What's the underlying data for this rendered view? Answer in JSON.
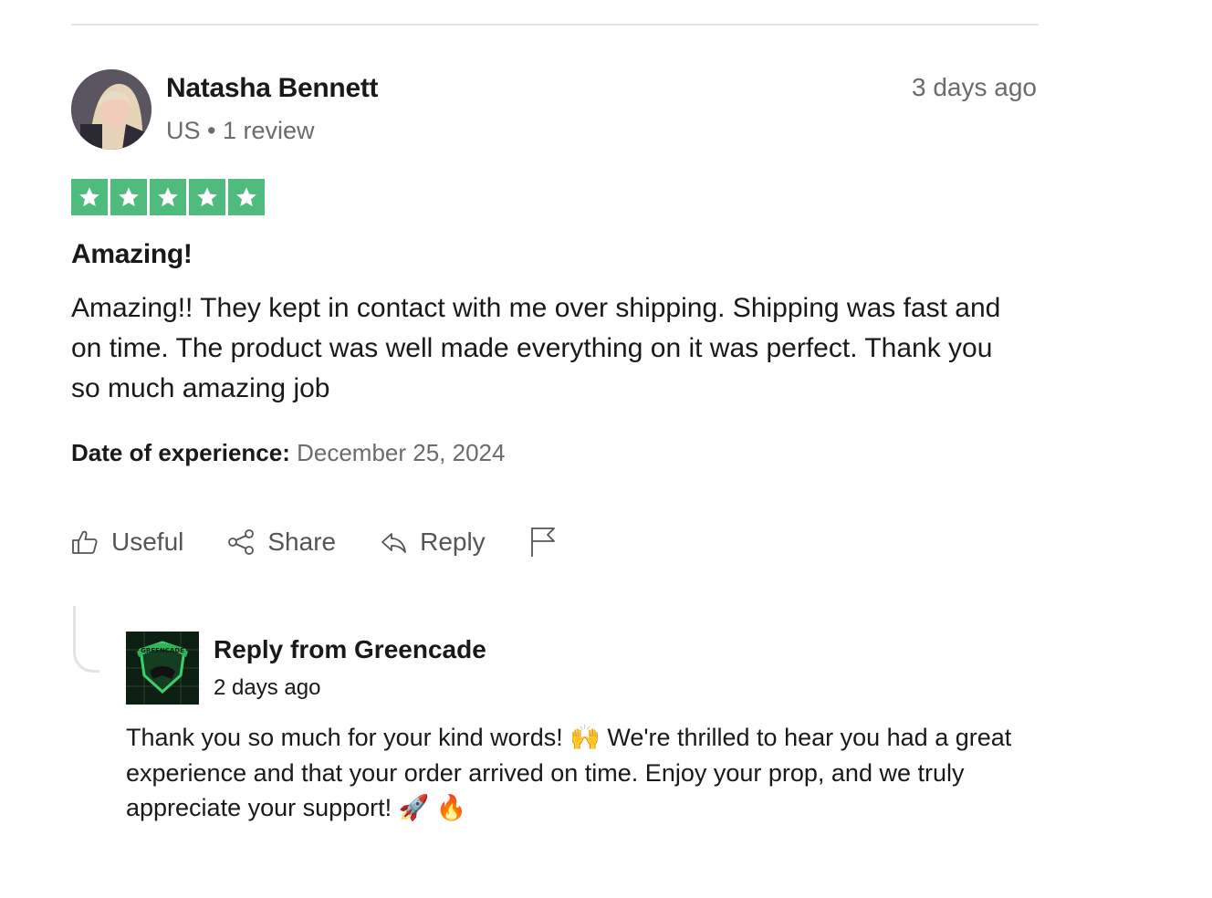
{
  "review": {
    "reviewer_name": "Natasha Bennett",
    "reviewer_meta": "US • 1 review",
    "time_ago": "3 days ago",
    "rating": 5,
    "rating_max": 5,
    "star_color": "#4fbb7d",
    "title": "Amazing!",
    "body": "Amazing!! They kept in contact with me over shipping. Shipping was fast and on time. The product was well made everything on it was perfect. Thank you so much amazing job",
    "experience_label": "Date of experience:",
    "experience_date": "December 25, 2024"
  },
  "actions": {
    "useful": "Useful",
    "share": "Share",
    "reply": "Reply",
    "flag_icon": "flag-icon"
  },
  "company_reply": {
    "header": "Reply from Greencade",
    "time_ago": "2 days ago",
    "logo_text": "GREENCADE",
    "body_part1": "Thank you so much for your kind words! ",
    "emoji1": "🙌",
    "body_part2": " We're thrilled to hear you had a great experience and that your order arrived on time. Enjoy your prop, and we truly appreciate your support! ",
    "emoji2": "🚀",
    "emoji3": "🔥"
  }
}
